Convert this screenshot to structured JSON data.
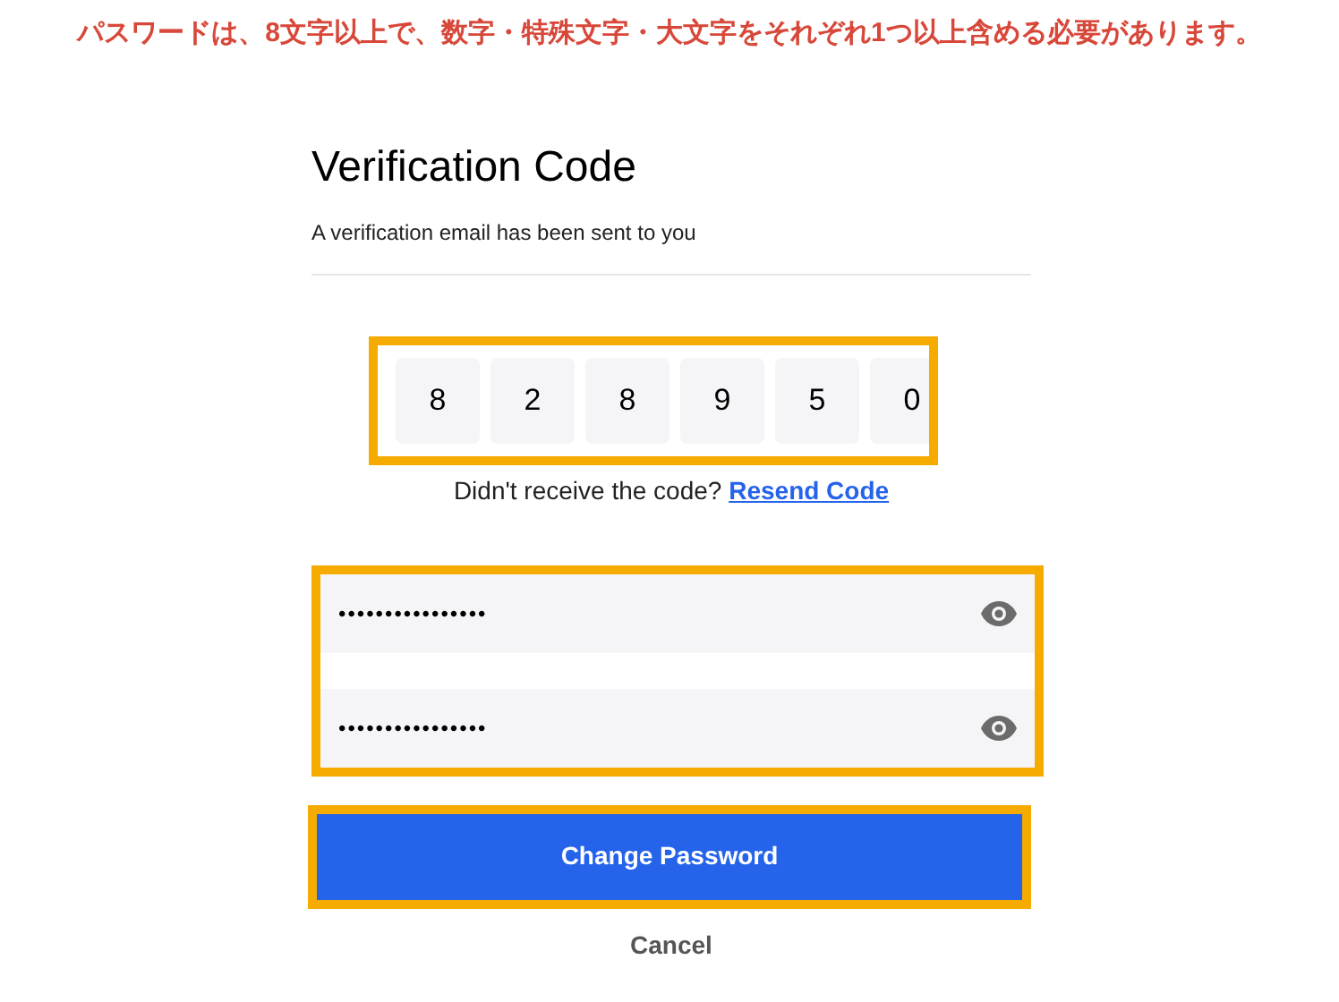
{
  "annotation": "パスワードは、8文字以上で、数字・特殊文字・大文字をそれぞれ1つ以上含める必要があります。",
  "title": "Verification Code",
  "subtitle": "A verification email has been sent to you",
  "code_digits": [
    "8",
    "2",
    "8",
    "9",
    "5",
    "0"
  ],
  "resend": {
    "prompt": "Didn't receive the code?",
    "link": "Resend Code"
  },
  "password_fields": [
    {
      "value": "••••••••••••••••"
    },
    {
      "value": "••••••••••••••••"
    }
  ],
  "submit_button": "Change Password",
  "cancel_button": "Cancel"
}
